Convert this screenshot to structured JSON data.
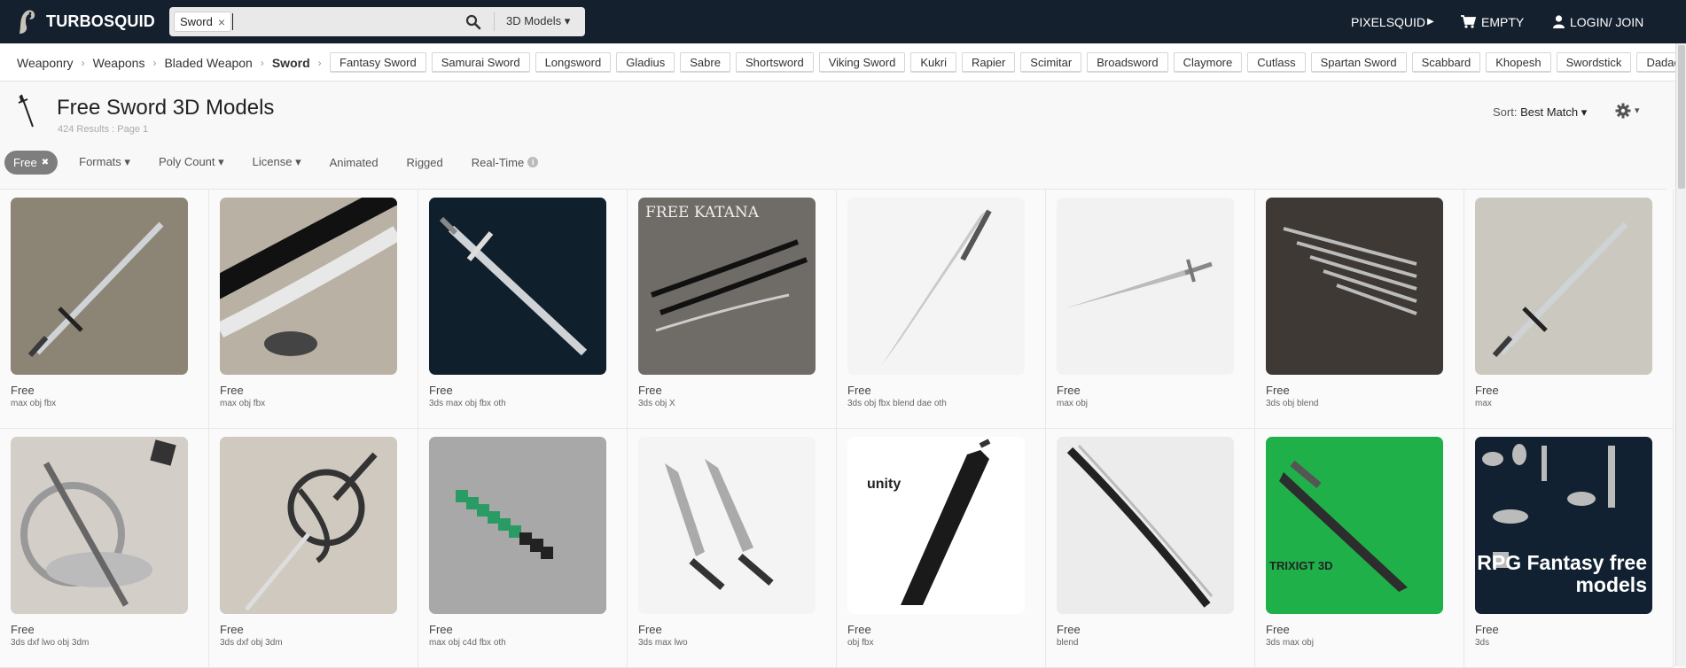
{
  "header": {
    "logo_text": "TURBOSQUID",
    "search_chip": "Sword",
    "search_chip_close": "×",
    "search_category": "3D Models ▾",
    "pixelsquid": "PIXELSQUID",
    "pixelsquid_arrow": "▶",
    "cart": "EMPTY",
    "login": "LOGIN/ JOIN"
  },
  "breadcrumb": [
    "Weaponry",
    "Weapons",
    "Bladed Weapon",
    "Sword"
  ],
  "breadcrumb_sep": "›",
  "tags": [
    "Fantasy Sword",
    "Samurai Sword",
    "Longsword",
    "Gladius",
    "Sabre",
    "Shortsword",
    "Viking Sword",
    "Kukri",
    "Rapier",
    "Scimitar",
    "Broadsword",
    "Claymore",
    "Cutlass",
    "Spartan Sword",
    "Scabbard",
    "Khopesh",
    "Swordstick",
    "Dadao"
  ],
  "page": {
    "title": "Free Sword 3D Models",
    "results": "424 Results : Page 1",
    "sort_label": "Sort:",
    "sort_value": "Best Match ▾",
    "gear_caret": "▾"
  },
  "filters": {
    "active": "Free",
    "active_close": "✖",
    "items": [
      "Formats ▾",
      "Poly Count ▾",
      "License ▾",
      "Animated",
      "Rigged",
      "Real-Time"
    ],
    "info": "i"
  },
  "products": [
    {
      "price": "Free",
      "formats": "max obj fbx",
      "bg": "#8c8576",
      "kind": "longsword",
      "overlay": ""
    },
    {
      "price": "Free",
      "formats": "max obj fbx",
      "bg": "#b9b2a4",
      "kind": "katana-close",
      "overlay": ""
    },
    {
      "price": "Free",
      "formats": "3ds max obj fbx oth",
      "bg": "#0f1f2c",
      "kind": "shortsword",
      "overlay": ""
    },
    {
      "price": "Free",
      "formats": "3ds obj X",
      "bg": "#6f6b66",
      "kind": "katana-set",
      "overlay": "FREE KATANA"
    },
    {
      "price": "Free",
      "formats": "3ds obj fbx blend dae oth",
      "bg": "#f4f4f4",
      "kind": "elven",
      "overlay": ""
    },
    {
      "price": "Free",
      "formats": "max obj",
      "bg": "#f2f2f2",
      "kind": "fantasy-long",
      "overlay": ""
    },
    {
      "price": "Free",
      "formats": "3ds obj blend",
      "bg": "#3e3934",
      "kind": "set",
      "overlay": ""
    },
    {
      "price": "Free",
      "formats": "max",
      "bg": "#cbc8c0",
      "kind": "longsword2",
      "overlay": ""
    },
    {
      "price": "Free",
      "formats": "3ds dxf lwo obj 3dm",
      "bg": "#d3cec7",
      "kind": "rapier-guard",
      "overlay": ""
    },
    {
      "price": "Free",
      "formats": "3ds dxf obj 3dm",
      "bg": "#cfc9c0",
      "kind": "rapier",
      "overlay": ""
    },
    {
      "price": "Free",
      "formats": "max obj c4d fbx oth",
      "bg": "#a8a8a8",
      "kind": "pixel",
      "overlay": ""
    },
    {
      "price": "Free",
      "formats": "3ds max lwo",
      "bg": "#f4f4f4",
      "kind": "daggers",
      "overlay": ""
    },
    {
      "price": "Free",
      "formats": "obj fbx",
      "bg": "#ffffff",
      "kind": "buster",
      "overlay": "unity"
    },
    {
      "price": "Free",
      "formats": "blend",
      "bg": "#ececec",
      "kind": "katana-curve",
      "overlay": ""
    },
    {
      "price": "Free",
      "formats": "3ds max obj",
      "bg": "#1fb04a",
      "kind": "serrated",
      "overlay": "TRIXIGT 3D"
    },
    {
      "price": "Free",
      "formats": "3ds",
      "bg": "#122131",
      "kind": "rpg",
      "overlay": "RPG Fantasy free models"
    }
  ],
  "colors": {
    "header_bg": "#15202f",
    "active_filter": "#7e7e7e"
  }
}
